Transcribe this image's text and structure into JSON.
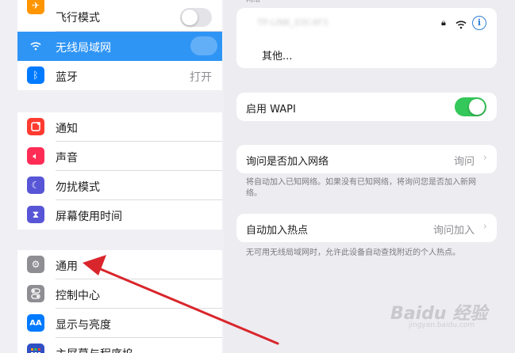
{
  "sidebar": {
    "group1": [
      {
        "label": "飞行模式",
        "icon": "airplane-icon",
        "color": "#ff9500"
      },
      {
        "label": "无线局域网",
        "icon": "wifi-icon",
        "color": "#2f95f5"
      },
      {
        "label": "蓝牙",
        "icon": "bluetooth-icon",
        "color": "#007aff",
        "value": "打开"
      }
    ],
    "group2": [
      {
        "label": "通知",
        "icon": "notifications-icon",
        "color": "#ff3b30"
      },
      {
        "label": "声音",
        "icon": "sound-icon",
        "color": "#ff2d55"
      },
      {
        "label": "勿扰模式",
        "icon": "moon-icon",
        "color": "#5856d6"
      },
      {
        "label": "屏幕使用时间",
        "icon": "hourglass-icon",
        "color": "#5856d6"
      }
    ],
    "group3": [
      {
        "label": "通用",
        "icon": "gear-icon",
        "color": "#8e8e93"
      },
      {
        "label": "控制中心",
        "icon": "control-center-icon",
        "color": "#8e8e93"
      },
      {
        "label": "显示与亮度",
        "icon": "display-icon",
        "color": "#007aff"
      },
      {
        "label": "主屏幕与程序坞",
        "icon": "home-screen-icon",
        "color": "#2f4fc4"
      }
    ]
  },
  "networks": {
    "section_header": "网络",
    "blurred_network": "TP-LINK_E0C4F3",
    "other_label": "其他..."
  },
  "wapi": {
    "label": "启用 WAPI",
    "enabled": true
  },
  "ask_to_join": {
    "label": "询问是否加入网络",
    "value": "询问",
    "footnote": "将自动加入已知网络。如果没有已知网络，将询问您是否加入新网络。"
  },
  "auto_hotspot": {
    "label": "自动加入热点",
    "value": "询问加入",
    "footnote": "无可用无线局域网时，允许此设备自动查找附近的个人热点。"
  },
  "watermark": {
    "text": "Baidu 经验",
    "sub": "jingyan.baidu.com"
  }
}
